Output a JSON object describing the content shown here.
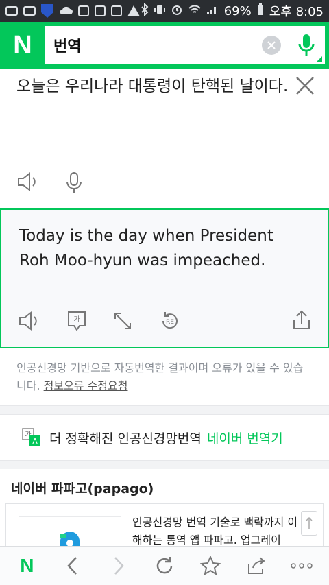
{
  "status_bar": {
    "battery": "69%",
    "time": "오후 8:05",
    "ni_icon": "NH"
  },
  "search": {
    "logo": "N",
    "query": "번역"
  },
  "source": {
    "text": "오늘은 우리나라 대통령이 탄핵된 날이다."
  },
  "result": {
    "text": "Today is the day when President Roh Moo-hyun was impeached.",
    "ko_badge": "가",
    "retry_badge": "RE"
  },
  "note": {
    "text": "인공신경망 기반으로 자동번역한 결과이며 오류가 있을 수 있습니다.",
    "link": "정보오류 수정요청"
  },
  "promo": {
    "text": "더 정확해진 인공신경망번역",
    "link": "네이버 번역기",
    "icon_top": "가",
    "icon_bottom": "A"
  },
  "papago": {
    "title": "네이버 파파고(papago)",
    "description": "인공신경망 번역 기술로 맥락까지 이해하는 통역 앱 파파고. 업그레이"
  },
  "bottom_nav": {
    "home": "N"
  },
  "colors": {
    "brand_green": "#03c75a"
  }
}
